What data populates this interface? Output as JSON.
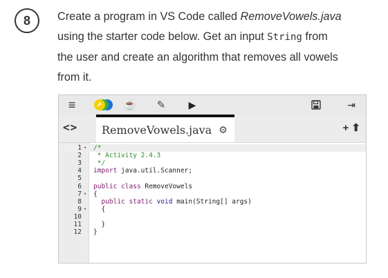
{
  "step": {
    "number": "8"
  },
  "prompt": {
    "line1_a": "Create a program in VS Code called ",
    "line1_filename": "RemoveVowels.java",
    "line2_a": "using the starter code below. Get an input ",
    "line2_code": "String",
    "line2_b": " from",
    "line3": "the user and create an algorithm that removes all vowels",
    "line4": "from it."
  },
  "toolbar": {
    "menu_icon": "≡",
    "java_icon": "☕",
    "pencil_icon": "✎",
    "run_icon": "▶",
    "login_icon": "⇥"
  },
  "tab": {
    "nav_label": "<>",
    "filename": "RemoveVowels.java",
    "gear_icon": "⚙",
    "add_icon": "+",
    "upload_icon": "⬆"
  },
  "code": {
    "lines": [
      {
        "n": "1",
        "fold": "▾",
        "text": "/*",
        "cls": "comment"
      },
      {
        "n": "2",
        "fold": "",
        "text": " * Activity 2.4.3",
        "cls": "comment"
      },
      {
        "n": "3",
        "fold": "",
        "text": " */",
        "cls": "comment"
      },
      {
        "n": "4",
        "fold": "",
        "text": "import java.util.Scanner;",
        "cls": "import"
      },
      {
        "n": "5",
        "fold": "",
        "text": "",
        "cls": ""
      },
      {
        "n": "6",
        "fold": "",
        "text": "public class RemoveVowels",
        "cls": "class"
      },
      {
        "n": "7",
        "fold": "▾",
        "text": "{",
        "cls": ""
      },
      {
        "n": "8",
        "fold": "",
        "text": "  public static void main(String[] args)",
        "cls": "main"
      },
      {
        "n": "9",
        "fold": "▾",
        "text": "  {",
        "cls": ""
      },
      {
        "n": "10",
        "fold": "",
        "text": "",
        "cls": ""
      },
      {
        "n": "11",
        "fold": "",
        "text": "  }",
        "cls": ""
      },
      {
        "n": "12",
        "fold": "",
        "text": "}",
        "cls": ""
      }
    ]
  },
  "colors": {
    "comment": "#2e8b2e",
    "keyword": "#7a1a6e",
    "circle_yellow": "#f5d000",
    "circle_green": "#3cb043",
    "circle_blue": "#1e6fd9"
  }
}
